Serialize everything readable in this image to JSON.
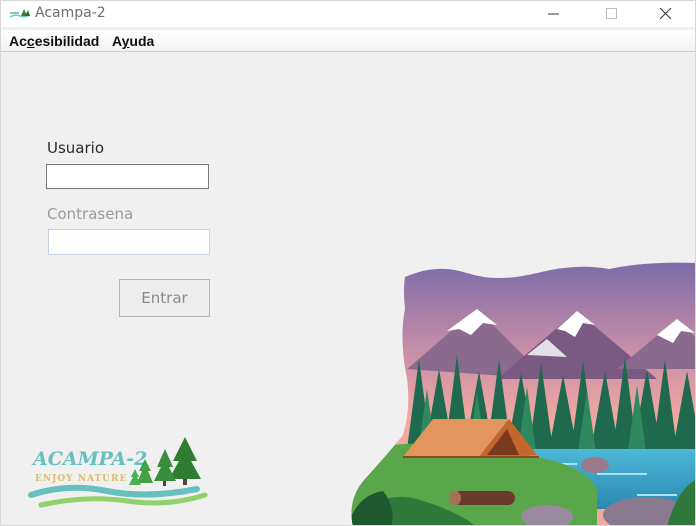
{
  "window": {
    "title": "Acampa-2"
  },
  "menubar": {
    "accessibility": {
      "before": "Ac",
      "mnemonic": "c",
      "after": "esibilidad"
    },
    "help": {
      "before": "A",
      "mnemonic": "y",
      "after": "uda"
    }
  },
  "login": {
    "user_label": "Usuario",
    "user_value": "",
    "password_label": "Contrasena",
    "password_value": "",
    "enter_label": "Entrar"
  },
  "logo": {
    "name": "ACAMPA-2",
    "tagline": "ENJOY NATURE"
  },
  "icons": [
    "app-icon",
    "minimize-icon",
    "maximize-icon",
    "close-icon"
  ],
  "colors": {
    "background": "#f0f0f0",
    "logo_text": "#68bfbf",
    "tree_green": "#2e7d32",
    "sky_top": "#7a6aa8",
    "sky_bottom": "#f0a8a0",
    "tent": "#d2703e",
    "lake": "#3ca6c6"
  }
}
